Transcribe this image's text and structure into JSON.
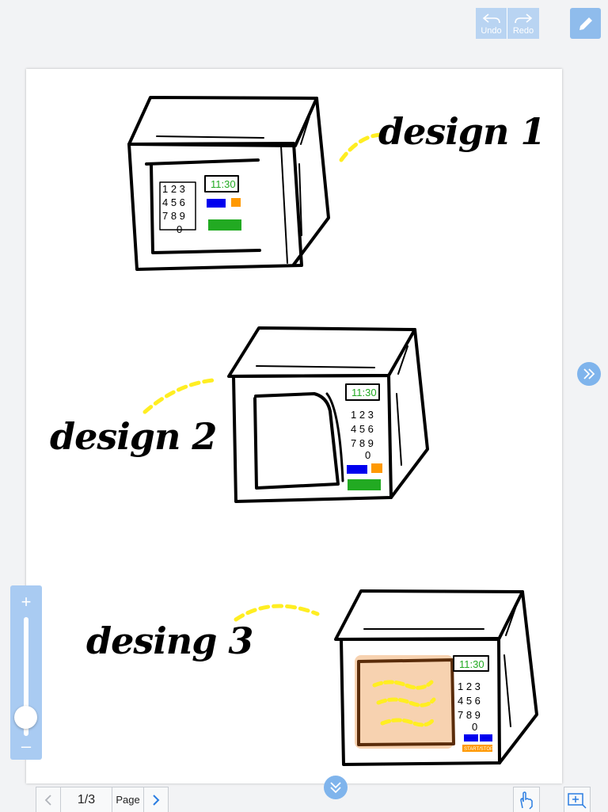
{
  "toolbar": {
    "undo_label": "Undo",
    "redo_label": "Redo",
    "pen_icon": "pencil-icon"
  },
  "canvas": {
    "captions": [
      "design 1",
      "design 2",
      "desing 3"
    ],
    "display": {
      "time": "11:30",
      "keypad": [
        "1",
        "2",
        "3",
        "4",
        "5",
        "6",
        "7",
        "8",
        "9",
        "0"
      ],
      "start_stop": "START/STOP"
    }
  },
  "zoom": {
    "plus": "+",
    "minus": "–",
    "level": 0.15
  },
  "pager": {
    "page_number": "1/3",
    "page_label": "Page"
  },
  "colors": {
    "accent": "#7fb4ec",
    "green": "#22aa22",
    "blue": "#0000ee",
    "orange": "#ff9900",
    "yellow": "#ffee22",
    "peach": "#f7d2b0"
  }
}
